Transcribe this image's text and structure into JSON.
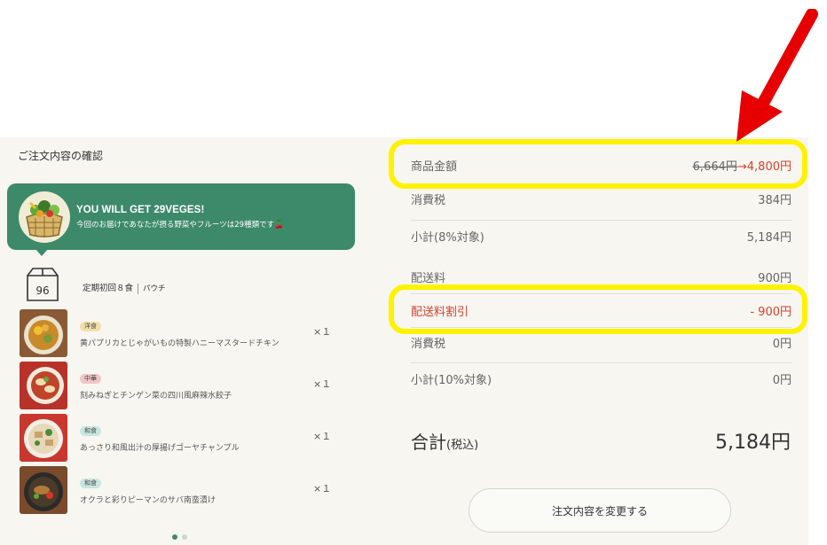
{
  "left": {
    "section_title": "ご注文内容の確認",
    "promo": {
      "title": "YOU WILL GET 29VEGES!",
      "subtitle": "今回のお届けであなたが摂る野菜やフルーツは29種類です🍒"
    },
    "plan": {
      "label": "定期初回８食",
      "type": "パウチ"
    },
    "items": [
      {
        "tag": "洋食",
        "name": "黄パプリカとじゃがいもの特製ハニーマスタードチキン",
        "qty": "×１"
      },
      {
        "tag": "中華",
        "name": "刻みねぎとチンゲン菜の四川風麻辣水餃子",
        "qty": "×１"
      },
      {
        "tag": "和食",
        "name": "あっさり和風出汁の厚揚げゴーヤチャンプル",
        "qty": "×１"
      },
      {
        "tag": "和食",
        "name": "オクラと彩りピーマンのサバ南蛮漬け",
        "qty": "×１"
      }
    ]
  },
  "summary": {
    "product_label": "商品金額",
    "product_old": "6,664円",
    "product_arrow": "→",
    "product_new": "4,800円",
    "tax8_label": "消費税",
    "tax8_value": "384円",
    "subtotal8_label": "小計(8%対象)",
    "subtotal8_value": "5,184円",
    "shipping_label": "配送料",
    "shipping_value": "900円",
    "shipping_discount_label": "配送料割引",
    "shipping_discount_value": "- 900円",
    "tax10_label": "消費税",
    "tax10_value": "0円",
    "subtotal10_label": "小計(10%対象)",
    "subtotal10_value": "0円",
    "total_label": "合計",
    "total_suffix": "(税込)",
    "total_value": "5,184円",
    "change_button": "注文内容を変更する"
  },
  "colors": {
    "accent_green": "#3d8a6a",
    "discount_red": "#d9402a",
    "highlight_yellow": "#fff200",
    "arrow_red": "#e60000"
  },
  "icons": [
    "basket-icon",
    "delivery-box-icon",
    "annotation-arrow-icon"
  ]
}
